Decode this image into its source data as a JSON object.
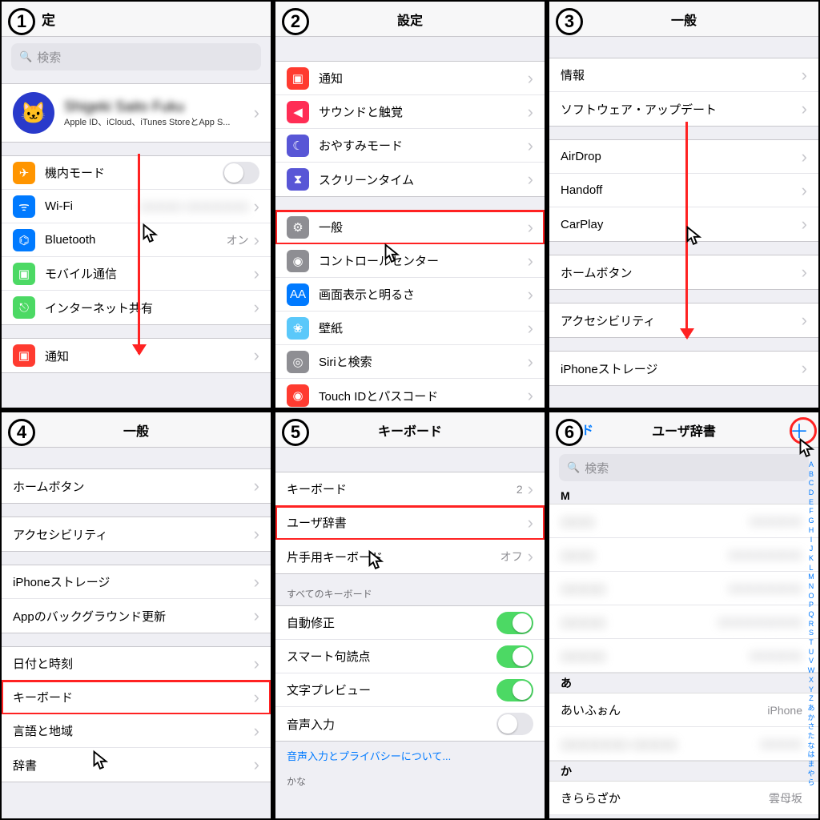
{
  "badges": [
    "1",
    "2",
    "3",
    "4",
    "5",
    "6"
  ],
  "p1": {
    "title": "設定",
    "search": "検索",
    "profile": {
      "name": "Shigeki Saito Fuku",
      "sub": "Apple ID、iCloud、iTunes StoreとApp S..."
    },
    "rows1": [
      {
        "label": "機内モード",
        "icon": "✈",
        "cls": "c-orange",
        "toggle": false
      },
      {
        "label": "Wi-Fi",
        "icon": "ᯤ",
        "cls": "c-blue",
        "value": "▢▢▢▢ ▢▢▢▢▢▢"
      },
      {
        "label": "Bluetooth",
        "icon": "⌬",
        "cls": "c-blue",
        "value": "オン"
      },
      {
        "label": "モバイル通信",
        "icon": "▣",
        "cls": "c-green"
      },
      {
        "label": "インターネット共有",
        "icon": "⎋",
        "cls": "c-green"
      }
    ],
    "rows2": [
      {
        "label": "通知",
        "icon": "▣",
        "cls": "c-red"
      }
    ]
  },
  "p2": {
    "title": "設定",
    "rowsA": [
      {
        "label": "通知",
        "icon": "▣",
        "cls": "c-red"
      },
      {
        "label": "サウンドと触覚",
        "icon": "◀",
        "cls": "c-pink"
      },
      {
        "label": "おやすみモード",
        "icon": "☾",
        "cls": "c-purple"
      },
      {
        "label": "スクリーンタイム",
        "icon": "⧗",
        "cls": "c-purple"
      }
    ],
    "rowsB": [
      {
        "label": "一般",
        "icon": "⚙",
        "cls": "c-gray",
        "hl": true
      },
      {
        "label": "コントロールセンター",
        "icon": "◉",
        "cls": "c-gray"
      },
      {
        "label": "画面表示と明るさ",
        "icon": "AA",
        "cls": "c-blue"
      },
      {
        "label": "壁紙",
        "icon": "❀",
        "cls": "c-bluee"
      },
      {
        "label": "Siriと検索",
        "icon": "◎",
        "cls": "c-gray"
      },
      {
        "label": "Touch IDとパスコード",
        "icon": "◉",
        "cls": "c-red"
      }
    ]
  },
  "p3": {
    "title": "一般",
    "g1": [
      {
        "label": "情報"
      },
      {
        "label": "ソフトウェア・アップデート"
      }
    ],
    "g2": [
      {
        "label": "AirDrop"
      },
      {
        "label": "Handoff"
      },
      {
        "label": "CarPlay"
      }
    ],
    "g3": [
      {
        "label": "ホームボタン"
      }
    ],
    "g4": [
      {
        "label": "アクセシビリティ"
      }
    ],
    "g5": [
      {
        "label": "iPhoneストレージ"
      }
    ]
  },
  "p4": {
    "title": "一般",
    "g1": [
      {
        "label": "ホームボタン"
      }
    ],
    "g2": [
      {
        "label": "アクセシビリティ"
      }
    ],
    "g3": [
      {
        "label": "iPhoneストレージ"
      },
      {
        "label": "Appのバックグラウンド更新"
      }
    ],
    "g4": [
      {
        "label": "日付と時刻"
      },
      {
        "label": "キーボード",
        "hl": true
      },
      {
        "label": "言語と地域"
      },
      {
        "label": "辞書"
      }
    ]
  },
  "p5": {
    "title": "キーボード",
    "g1": [
      {
        "label": "キーボード",
        "value": "2"
      },
      {
        "label": "ユーザ辞書",
        "hl": true
      },
      {
        "label": "片手用キーボード",
        "value": "オフ"
      }
    ],
    "sect": "すべてのキーボード",
    "g2": [
      {
        "label": "自動修正",
        "toggle": true,
        "on": true
      },
      {
        "label": "スマート句読点",
        "toggle": true,
        "on": true
      },
      {
        "label": "文字プレビュー",
        "toggle": true,
        "on": true
      },
      {
        "label": "音声入力",
        "toggle": true,
        "on": false
      }
    ],
    "link": "音声入力とプライバシーについて...",
    "sect2": "かな"
  },
  "p6": {
    "title": "ユーザ辞書",
    "back": "ボード",
    "search": "検索",
    "sM": "M",
    "sA": "あ",
    "sK": "か",
    "entries": [
      {
        "word": "あいふぉん",
        "reading": "iPhone"
      },
      {
        "word": "きららざか",
        "reading": "雲母坂"
      }
    ],
    "index": [
      "A",
      "B",
      "C",
      "D",
      "E",
      "F",
      "G",
      "H",
      "I",
      "J",
      "K",
      "L",
      "M",
      "N",
      "O",
      "P",
      "Q",
      "R",
      "S",
      "T",
      "U",
      "V",
      "W",
      "X",
      "Y",
      "Z",
      "あ",
      "か",
      "さ",
      "た",
      "な",
      "は",
      "ま",
      "や",
      "ら"
    ]
  }
}
